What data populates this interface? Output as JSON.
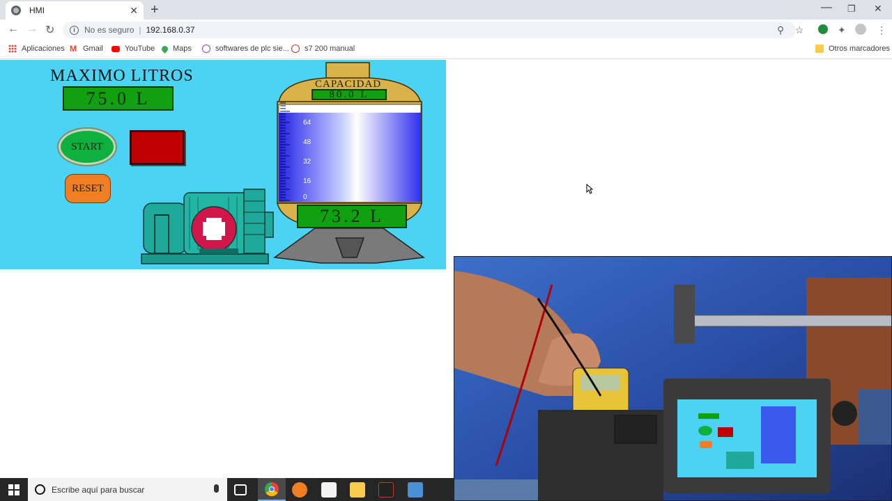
{
  "browser": {
    "tab_title": "HMI",
    "new_tab": "+",
    "security_text": "No es seguro",
    "separator": "|",
    "url": "192.168.0.37",
    "window_controls": {
      "minimize": "—",
      "maximize": "❐",
      "close": "✕"
    },
    "tab_close": "✕"
  },
  "bookmarks": {
    "items": [
      {
        "label": "Aplicaciones",
        "icon": "apps-grid-icon"
      },
      {
        "label": "Gmail",
        "icon": "gmail-icon"
      },
      {
        "label": "YouTube",
        "icon": "youtube-icon"
      },
      {
        "label": "Maps",
        "icon": "maps-icon"
      },
      {
        "label": "softwares de plc sie...",
        "icon": "site-icon"
      },
      {
        "label": "s7 200 manual",
        "icon": "site-icon"
      }
    ],
    "other": "Otros marcadores"
  },
  "hmi": {
    "title": "MAXIMO LITROS",
    "max_liters": "75.0 L",
    "start_label": "START",
    "reset_label": "RESET",
    "capacity_label": "CAPACIDAD",
    "capacity_value": "80.0 L",
    "current_level": "73.2 L",
    "scale_ticks": [
      "64",
      "48",
      "32",
      "16",
      "0"
    ],
    "level_fraction": 0.915,
    "colors": {
      "background": "#4cd2f2",
      "display_green": "#10a010",
      "stop_red": "#c00000",
      "reset_orange": "#f07e22",
      "tank_gold": "#d9b24a",
      "liquid_blue": "#2a2aee"
    }
  },
  "taskbar": {
    "search_placeholder": "Escribe aquí para buscar"
  }
}
